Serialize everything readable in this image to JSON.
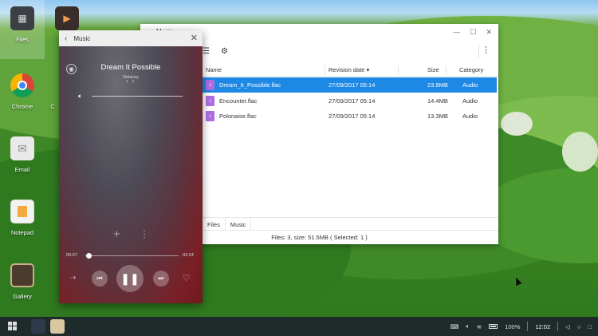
{
  "desktop": {
    "icons": [
      {
        "label": "Files"
      },
      {
        "label": "Chrome"
      },
      {
        "label": "Email"
      },
      {
        "label": "Notepad"
      },
      {
        "label": "Gallery"
      },
      {
        "label": "C"
      }
    ]
  },
  "music": {
    "window_title": "Music",
    "song_title": "Dream It Possible",
    "artist": "Delacey",
    "time_current": "00:07",
    "time_total": "03:24",
    "progress_fraction": 0.03
  },
  "files": {
    "window_title": "Music",
    "columns": {
      "name": "Name",
      "date": "Revision date",
      "size": "Size",
      "category": "Category"
    },
    "rows": [
      {
        "name": "Dream_It_Possible.flac",
        "date": "27/09/2017 05:14",
        "size": "23.8MB",
        "category": "Audio",
        "selected": true
      },
      {
        "name": "Encounter.flac",
        "date": "27/09/2017 05:14",
        "size": "14.4MB",
        "category": "Audio",
        "selected": false
      },
      {
        "name": "Polonaise.flac",
        "date": "27/09/2017 05:14",
        "size": "13.3MB",
        "category": "Audio",
        "selected": false
      }
    ],
    "tabs": [
      "Files",
      "Music"
    ],
    "status": "Files: 3, size: 51.5MB ( Selected: 1 )"
  },
  "taskbar": {
    "battery": "100%",
    "time": "12:02"
  },
  "colors": {
    "selection": "#1e88e5",
    "file_icon": "#b06de3",
    "taskbar": "#1f2a2a"
  }
}
